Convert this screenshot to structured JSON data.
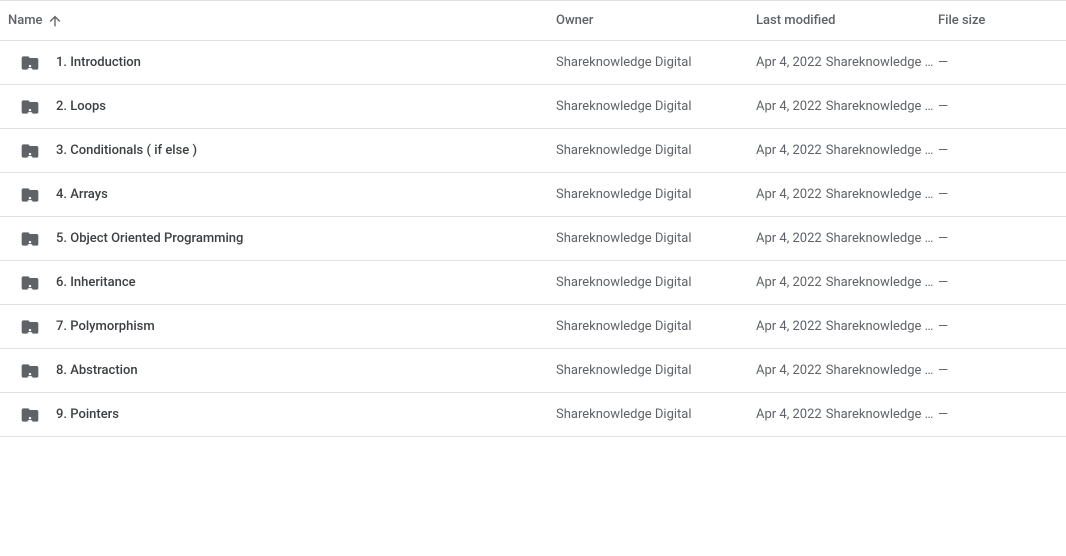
{
  "headers": {
    "name": "Name",
    "owner": "Owner",
    "modified": "Last modified",
    "size": "File size"
  },
  "rows": [
    {
      "name": "1. Introduction",
      "owner": "Shareknowledge Digital",
      "modified_date": "Apr 4, 2022",
      "modified_by": "Shareknowledge D…",
      "size": "—"
    },
    {
      "name": "2. Loops",
      "owner": "Shareknowledge Digital",
      "modified_date": "Apr 4, 2022",
      "modified_by": "Shareknowledge D…",
      "size": "—"
    },
    {
      "name": "3. Conditionals ( if else )",
      "owner": "Shareknowledge Digital",
      "modified_date": "Apr 4, 2022",
      "modified_by": "Shareknowledge D…",
      "size": "—"
    },
    {
      "name": "4. Arrays",
      "owner": "Shareknowledge Digital",
      "modified_date": "Apr 4, 2022",
      "modified_by": "Shareknowledge D…",
      "size": "—"
    },
    {
      "name": "5. Object Oriented Programming",
      "owner": "Shareknowledge Digital",
      "modified_date": "Apr 4, 2022",
      "modified_by": "Shareknowledge D…",
      "size": "—"
    },
    {
      "name": "6. Inheritance",
      "owner": "Shareknowledge Digital",
      "modified_date": "Apr 4, 2022",
      "modified_by": "Shareknowledge D…",
      "size": "—"
    },
    {
      "name": "7. Polymorphism",
      "owner": "Shareknowledge Digital",
      "modified_date": "Apr 4, 2022",
      "modified_by": "Shareknowledge D…",
      "size": "—"
    },
    {
      "name": "8. Abstraction",
      "owner": "Shareknowledge Digital",
      "modified_date": "Apr 4, 2022",
      "modified_by": "Shareknowledge D…",
      "size": "—"
    },
    {
      "name": "9. Pointers",
      "owner": "Shareknowledge Digital",
      "modified_date": "Apr 4, 2022",
      "modified_by": "Shareknowledge D…",
      "size": "—"
    }
  ]
}
